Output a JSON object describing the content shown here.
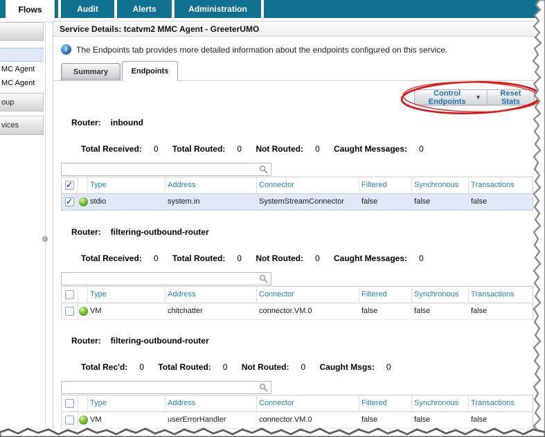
{
  "nav": {
    "tabs": [
      {
        "label": "Flows",
        "active": true
      },
      {
        "label": "Audit",
        "active": false
      },
      {
        "label": "Alerts",
        "active": false
      },
      {
        "label": "Administration",
        "active": false
      }
    ]
  },
  "sidebar": {
    "items": [
      {
        "label": "MC Agent"
      },
      {
        "label": "MC Agent"
      }
    ],
    "panels": [
      {
        "label": ""
      },
      {
        "label": "oup"
      },
      {
        "label": "vices"
      }
    ]
  },
  "header": {
    "title": "Service Details: tcatvm2 MMC Agent - GreeterUMO"
  },
  "info": {
    "text": "The Endpoints tab provides more detailed information about the endpoints configured on this service."
  },
  "detail_tabs": [
    {
      "label": "Summary",
      "active": false
    },
    {
      "label": "Endpoints",
      "active": true
    }
  ],
  "toolbar": {
    "control_endpoints_label": "Control Endpoints",
    "reset_stats_label": "Reset Stats"
  },
  "search": {
    "value": "",
    "placeholder": ""
  },
  "routers": [
    {
      "label": "Router:",
      "name": "inbound",
      "stats": [
        {
          "label": "Total Received:",
          "value": "0"
        },
        {
          "label": "Total Routed:",
          "value": "0"
        },
        {
          "label": "Not Routed:",
          "value": "0"
        },
        {
          "label": "Caught Messages:",
          "value": "0"
        }
      ],
      "table": {
        "header_checked": true,
        "columns": [
          "Type",
          "Address",
          "Connector",
          "Filtered",
          "Synchronous",
          "Transactions"
        ],
        "rows": [
          {
            "checked": true,
            "selected": true,
            "status": "ok",
            "cells": [
              "stdio",
              "system.in",
              "SystemStreamConnector",
              "false",
              "false",
              "false"
            ]
          }
        ]
      }
    },
    {
      "label": "Router:",
      "name": "filtering-outbound-router",
      "stats": [
        {
          "label": "Total Received:",
          "value": "0"
        },
        {
          "label": "Total Routed:",
          "value": "0"
        },
        {
          "label": "Not Routed:",
          "value": "0"
        },
        {
          "label": "Caught Messages:",
          "value": "0"
        }
      ],
      "table": {
        "header_checked": false,
        "columns": [
          "Type",
          "Address",
          "Connector",
          "Filtered",
          "Synchronous",
          "Transactions"
        ],
        "rows": [
          {
            "checked": false,
            "selected": false,
            "status": "ok",
            "cells": [
              "VM",
              "chitchatter",
              "connector.VM.0",
              "false",
              "false",
              "false"
            ]
          }
        ]
      }
    },
    {
      "label": "Router:",
      "name": "filtering-outbound-router",
      "stats": [
        {
          "label": "Total Rec'd:",
          "value": "0"
        },
        {
          "label": "Total Routed:",
          "value": "0"
        },
        {
          "label": "Not Routed:",
          "value": "0"
        },
        {
          "label": "Caught Msgs:",
          "value": "0"
        }
      ],
      "table": {
        "header_checked": false,
        "columns": [
          "Type",
          "Address",
          "Connector",
          "Filtered",
          "Synchronous",
          "Transactions"
        ],
        "rows": [
          {
            "checked": false,
            "selected": false,
            "status": "ok",
            "cells": [
              "VM",
              "userErrorHandler",
              "connector.VM.0",
              "false",
              "false",
              "false"
            ]
          }
        ]
      }
    }
  ],
  "icons": {
    "info_glyph": "i",
    "dropdown_caret": "▾",
    "check_glyph": "✓"
  },
  "colors": {
    "nav_teal": "#10708f",
    "table_header_text": "#267fa8",
    "button_text": "#2471a3",
    "selected_row_bg": "#dfe8f6",
    "annotation_red": "#dd1111",
    "status_green": "#62a820"
  }
}
